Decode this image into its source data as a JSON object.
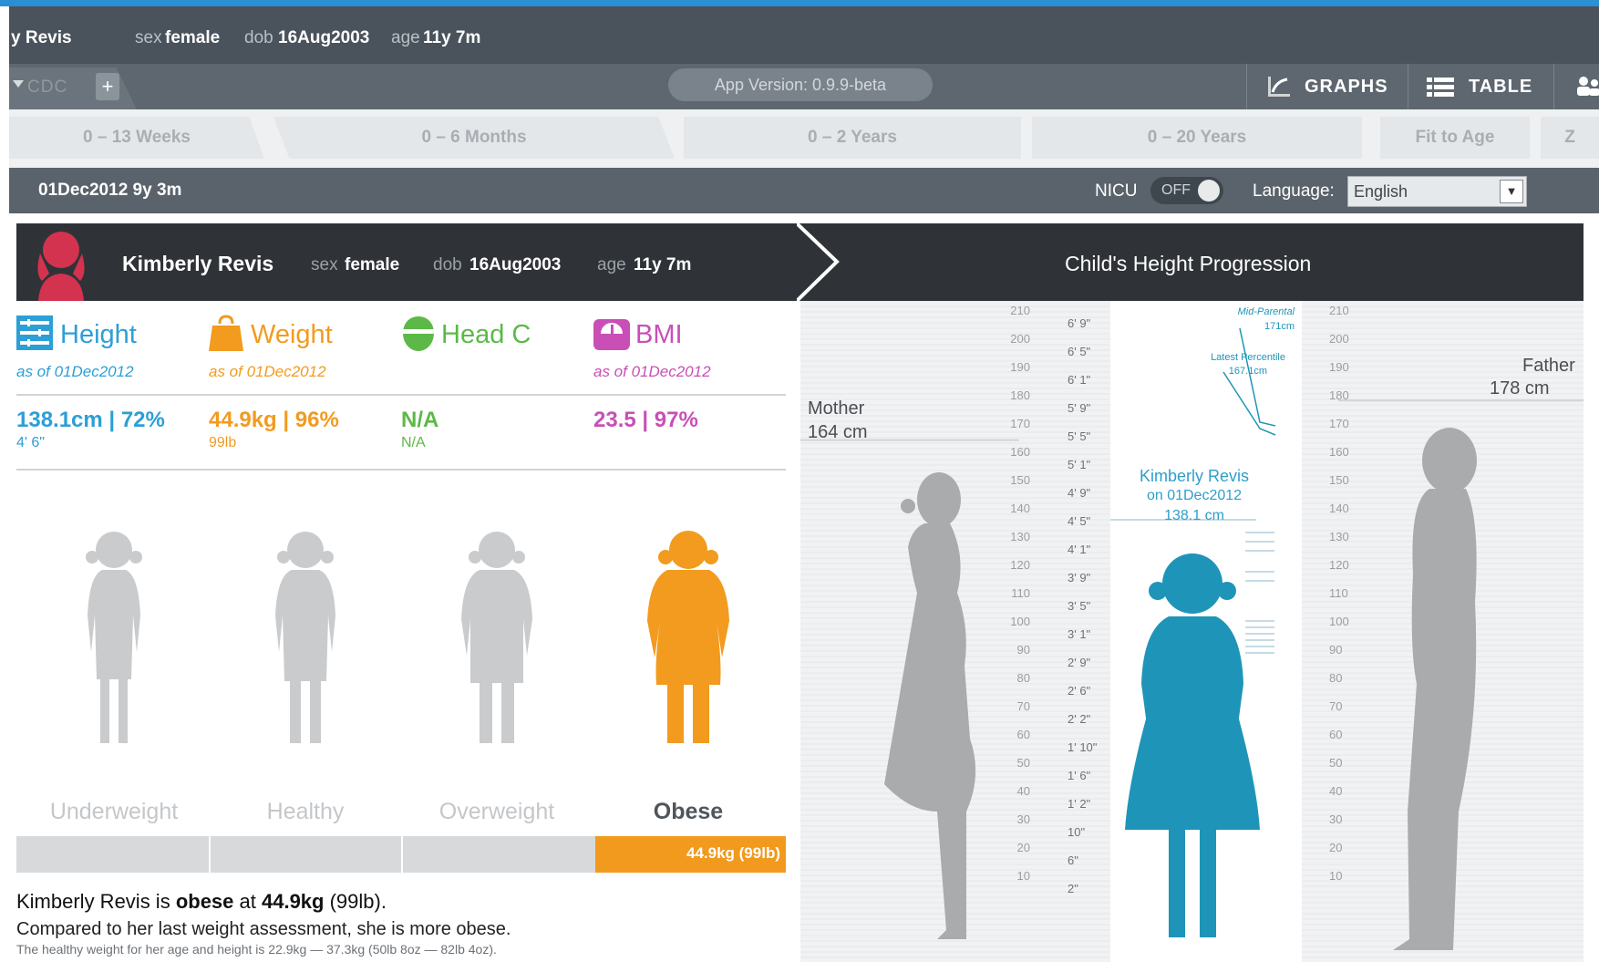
{
  "patient_bar": {
    "name": "y Revis",
    "sex_label": "sex",
    "sex": "female",
    "dob_label": "dob",
    "dob": "16Aug2003",
    "age_label": "age",
    "age": "11y 7m"
  },
  "toolbar": {
    "chart_tab": "CDC",
    "add_label": "+",
    "app_version": "App Version: 0.9.9-beta",
    "graphs_label": "GRAPHS",
    "table_label": "TABLE"
  },
  "ranges": [
    "0 – 13 Weeks",
    "0 – 6 Months",
    "0 – 2 Years",
    "0 – 20 Years",
    "Fit to Age",
    "Z"
  ],
  "status": {
    "date_age": "01Dec2012  9y 3m",
    "nicu_label": "NICU",
    "nicu_state": "OFF",
    "language_label": "Language:",
    "language_value": "English"
  },
  "card": {
    "name": "Kimberly Revis",
    "sex_label": "sex",
    "sex": "female",
    "dob_label": "dob",
    "dob": "16Aug2003",
    "age_label": "age",
    "age": "11y 7m",
    "progress_title": "Child's Height Progression"
  },
  "metrics": {
    "height": {
      "title": "Height",
      "asof": "as of 01Dec2012",
      "value": "138.1cm",
      "percentile": "72%",
      "sub": "4' 6\"",
      "color": "#2c9fd6"
    },
    "weight": {
      "title": "Weight",
      "asof": "as of 01Dec2012",
      "value": "44.9kg",
      "percentile": "96%",
      "sub": "99lb",
      "color": "#f29b1e"
    },
    "headc": {
      "title": "Head C",
      "value": "N/A",
      "sub": "N/A",
      "color": "#5cb947"
    },
    "bmi": {
      "title": "BMI",
      "asof": "as of 01Dec2012",
      "value": "23.5",
      "percentile": "97%",
      "color": "#c94fb6"
    }
  },
  "categories": [
    "Underweight",
    "Healthy",
    "Overweight",
    "Obese"
  ],
  "active_category_index": 3,
  "bar_label": "44.9kg (99lb)",
  "summary": {
    "s1_a": "Kimberly Revis is ",
    "s1_b": "obese",
    "s1_c": " at ",
    "s1_d": "44.9kg",
    "s1_e": " (99lb).",
    "s2": "Compared to her last weight assessment, she is more obese.",
    "s3": "The healthy weight for her age and height is 22.9kg — 37.3kg (50lb 8oz — 82lb 4oz)."
  },
  "progression": {
    "mother_label": "Mother",
    "mother_cm": "164 cm",
    "mother_height_cm": 164,
    "father_label": "Father",
    "father_cm": "178 cm",
    "father_height_cm": 178,
    "child_name": "Kimberly Revis",
    "child_date": "on 01Dec2012",
    "child_cm": "138.1 cm",
    "child_height_cm": 138.1,
    "mid_parental_label": "Mid-Parental",
    "mid_parental_value": "171cm",
    "latest_percentile_label": "Latest Percentile",
    "latest_percentile_value": "167.1cm",
    "cm_ticks": [
      "210",
      "200",
      "190",
      "180",
      "170",
      "160",
      "150",
      "140",
      "130",
      "120",
      "110",
      "100",
      "90",
      "80",
      "70",
      "60",
      "50",
      "40",
      "30",
      "20",
      "10"
    ],
    "ft_ticks": [
      "6' 9\"",
      "6' 5\"",
      "6' 1\"",
      "5' 9\"",
      "5' 5\"",
      "5' 1\"",
      "4' 9\"",
      "4' 5\"",
      "4' 1\"",
      "3' 9\"",
      "3' 5\"",
      "3' 1\"",
      "2' 9\"",
      "2' 6\"",
      "2' 2\"",
      "1' 10\"",
      "1' 6\"",
      "1' 2\"",
      "10\"",
      "6\"",
      "2\""
    ],
    "child_color": "#1e95b8",
    "adult_color": "#a9abad"
  }
}
